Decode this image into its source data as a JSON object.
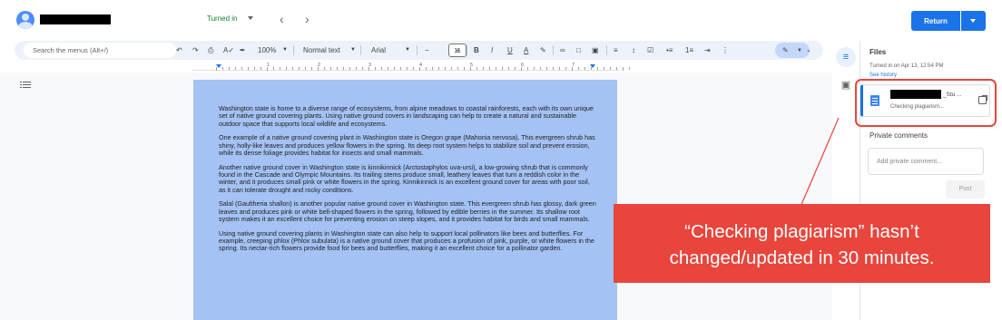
{
  "header": {
    "status": "Turned in",
    "prev_icon": "chevron-left-icon",
    "next_icon": "chevron-right-icon",
    "return_label": "Return"
  },
  "toolbar": {
    "search_placeholder": "Search the menus (Alt+/)",
    "zoom": "100%",
    "style": "Normal text",
    "font": "Arial",
    "font_size": "11",
    "minus": "−",
    "plus": "+",
    "bold": "B",
    "italic": "I",
    "underline": "U",
    "text_color": "A"
  },
  "ruler": {
    "numbers": [
      "1",
      "2",
      "3",
      "4",
      "5",
      "6",
      "7"
    ]
  },
  "document": {
    "paragraphs": [
      "Washington state is home to a diverse range of ecosystems, from alpine meadows to coastal rainforests, each with its own unique set of native ground covering plants. Using native ground covers in landscaping can help to create a natural and sustainable outdoor space that supports local wildlife and ecosystems.",
      "One example of a native ground covering plant in Washington state is Oregon grape (Mahonia nervosa). This evergreen shrub has shiny, holly-like leaves and produces yellow flowers in the spring. Its deep root system helps to stabilize soil and prevent erosion, while its dense foliage provides habitat for insects and small mammals.",
      "Another native ground cover in Washington state is kinnikinnick (Arctostaphylos uva-ursi), a low-growing shrub that is commonly found in the Cascade and Olympic Mountains. Its trailing stems produce small, leathery leaves that turn a reddish color in the winter, and it produces small pink or white flowers in the spring. Kinnikinnick is an excellent ground cover for areas with poor soil, as it can tolerate drought and rocky conditions.",
      "Salal (Gaultheria shallon) is another popular native ground cover in Washington state. This evergreen shrub has glossy, dark green leaves and produces pink or white bell-shaped flowers in the spring, followed by edible berries in the summer. Its shallow root system makes it an excellent choice for preventing erosion on steep slopes, and it provides habitat for birds and small mammals.",
      "Using native ground covering plants in Washington state can also help to support local pollinators like bees and butterflies. For example, creeping phlox (Phlox subulata) is a native ground cover that produces a profusion of pink, purple, or white flowers in the spring. Its nectar-rich flowers provide food for bees and butterflies, making it an excellent choice for a pollinator garden."
    ]
  },
  "files_panel": {
    "title": "Files",
    "turned_in": "Turned in on Apr 13, 12:54 PM",
    "see_history": "See history",
    "file_name_suffix": "_Stu ...",
    "file_status": "Checking plagiarism...",
    "private_comments": "Private comments",
    "comment_placeholder": "Add private comment...",
    "post": "Post"
  },
  "annotation": {
    "line1": "“Checking plagiarism” hasn’t",
    "line2": "changed/updated in 30 minutes.",
    "color": "#e8453c"
  }
}
